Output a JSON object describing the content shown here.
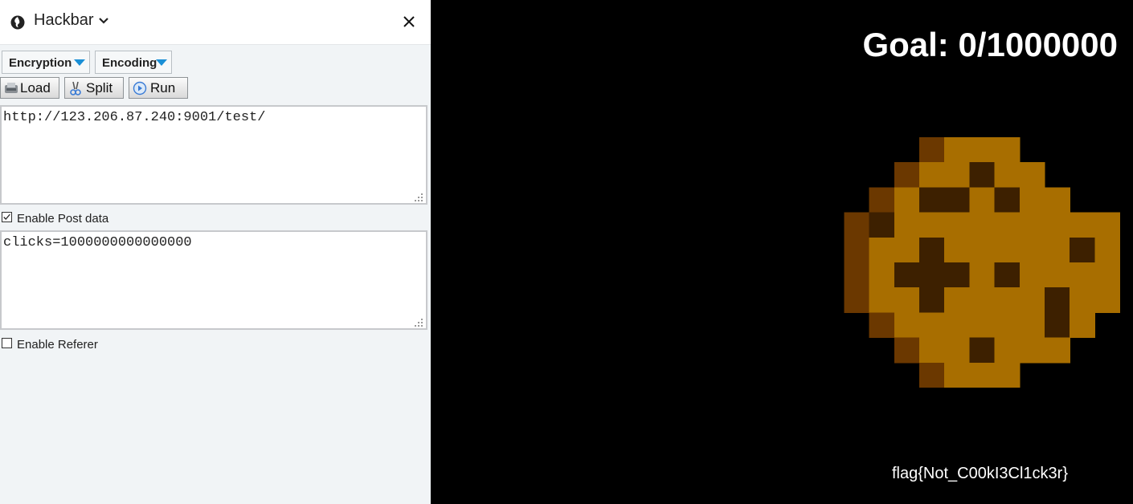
{
  "hackbar": {
    "title": "Hackbar",
    "menus": {
      "encryption": "Encryption",
      "encoding": "Encoding"
    },
    "buttons": {
      "load": "Load",
      "split": "Split",
      "run": "Run"
    },
    "url_value": "http://123.206.87.240:9001/test/",
    "post": {
      "label": "Enable Post data",
      "checked": true,
      "value": "clicks=1000000000000000"
    },
    "referer": {
      "label": "Enable Referer",
      "checked": false
    },
    "icons": {
      "logo": "firefox-logo-icon",
      "dropdown": "chevron-down-icon",
      "close": "close-icon"
    }
  },
  "game": {
    "goal_text": "Goal: 0/1000000",
    "flag_text": "flag{Not_C00kI3Cl1ck3r}",
    "cookie_colors": {
      "dough": "#a86e00",
      "dark_edge": "#6b3800",
      "chip": "#3d2000"
    }
  }
}
